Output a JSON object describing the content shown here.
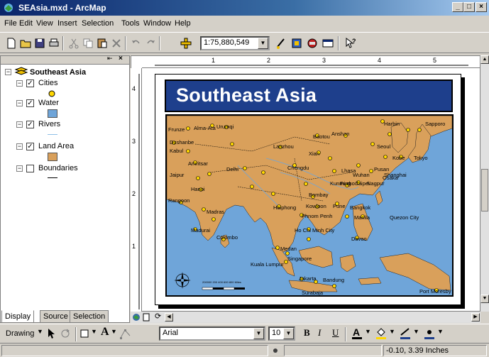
{
  "window": {
    "title": "SEAsia.mxd - ArcMap",
    "min_btn": "_",
    "max_btn": "□",
    "close_btn": "×"
  },
  "menu": [
    "File",
    "Edit",
    "View",
    "Insert",
    "Selection",
    "Tools",
    "Window",
    "Help"
  ],
  "toolbar": {
    "scale": "1:75,880,549"
  },
  "toc": {
    "root": "Southeast Asia",
    "layers": [
      {
        "name": "Cities",
        "checked": true
      },
      {
        "name": "Water",
        "checked": true
      },
      {
        "name": "Rivers",
        "checked": true
      },
      {
        "name": "Land Area",
        "checked": true
      },
      {
        "name": "Boundaries",
        "checked": false
      }
    ],
    "tabs": [
      "Display",
      "Source",
      "Selection"
    ]
  },
  "ruler": {
    "h_ticks": [
      "1",
      "2",
      "3",
      "4",
      "5"
    ],
    "v_ticks": [
      "4",
      "3",
      "2",
      "1"
    ]
  },
  "map": {
    "title": "Southeast Asia",
    "cities": [
      "Harbin",
      "Sapporo",
      "Frunze",
      "Alma-Ata",
      "Urumqi",
      "Baotou",
      "Anshan",
      "Dushanbe",
      "Kabul",
      "Lanzhou",
      "Xian",
      "Seoul",
      "Kobe",
      "Tokyo",
      "Amritsar",
      "Chengdu",
      "Pusan",
      "Osaka",
      "Delhi",
      "Lhasa",
      "Wuhan",
      "Shanghai",
      "Jaipur",
      "Kunming",
      "Fuzhou",
      "Taipei",
      "Nagpur",
      "Hanoi",
      "Bombay",
      "Rangoon",
      "Haiphong",
      "Kowloon",
      "Pune",
      "Bangkok",
      "Manila",
      "Quezon City",
      "Madras",
      "Phnom Penh",
      "Madurai",
      "Colombo",
      "Ho Chi Minh City",
      "Davao",
      "Medan",
      "Singapore",
      "Kuala Lumpur",
      "Jakarta",
      "Bandung",
      "Surabaja",
      "Port Moresby"
    ],
    "scalebar": "200000 200 400 600 800 Miles"
  },
  "draw": {
    "label": "Drawing",
    "font": "Arial",
    "size": "10",
    "bold": "B",
    "italic": "I",
    "underline": "U"
  },
  "status": {
    "coords": "-0.10, 3.39 Inches"
  },
  "colors": {
    "land": "#d9a05b",
    "water": "#6fa5d9",
    "title_bg": "#1e3f8c",
    "city": "#ffd700"
  }
}
